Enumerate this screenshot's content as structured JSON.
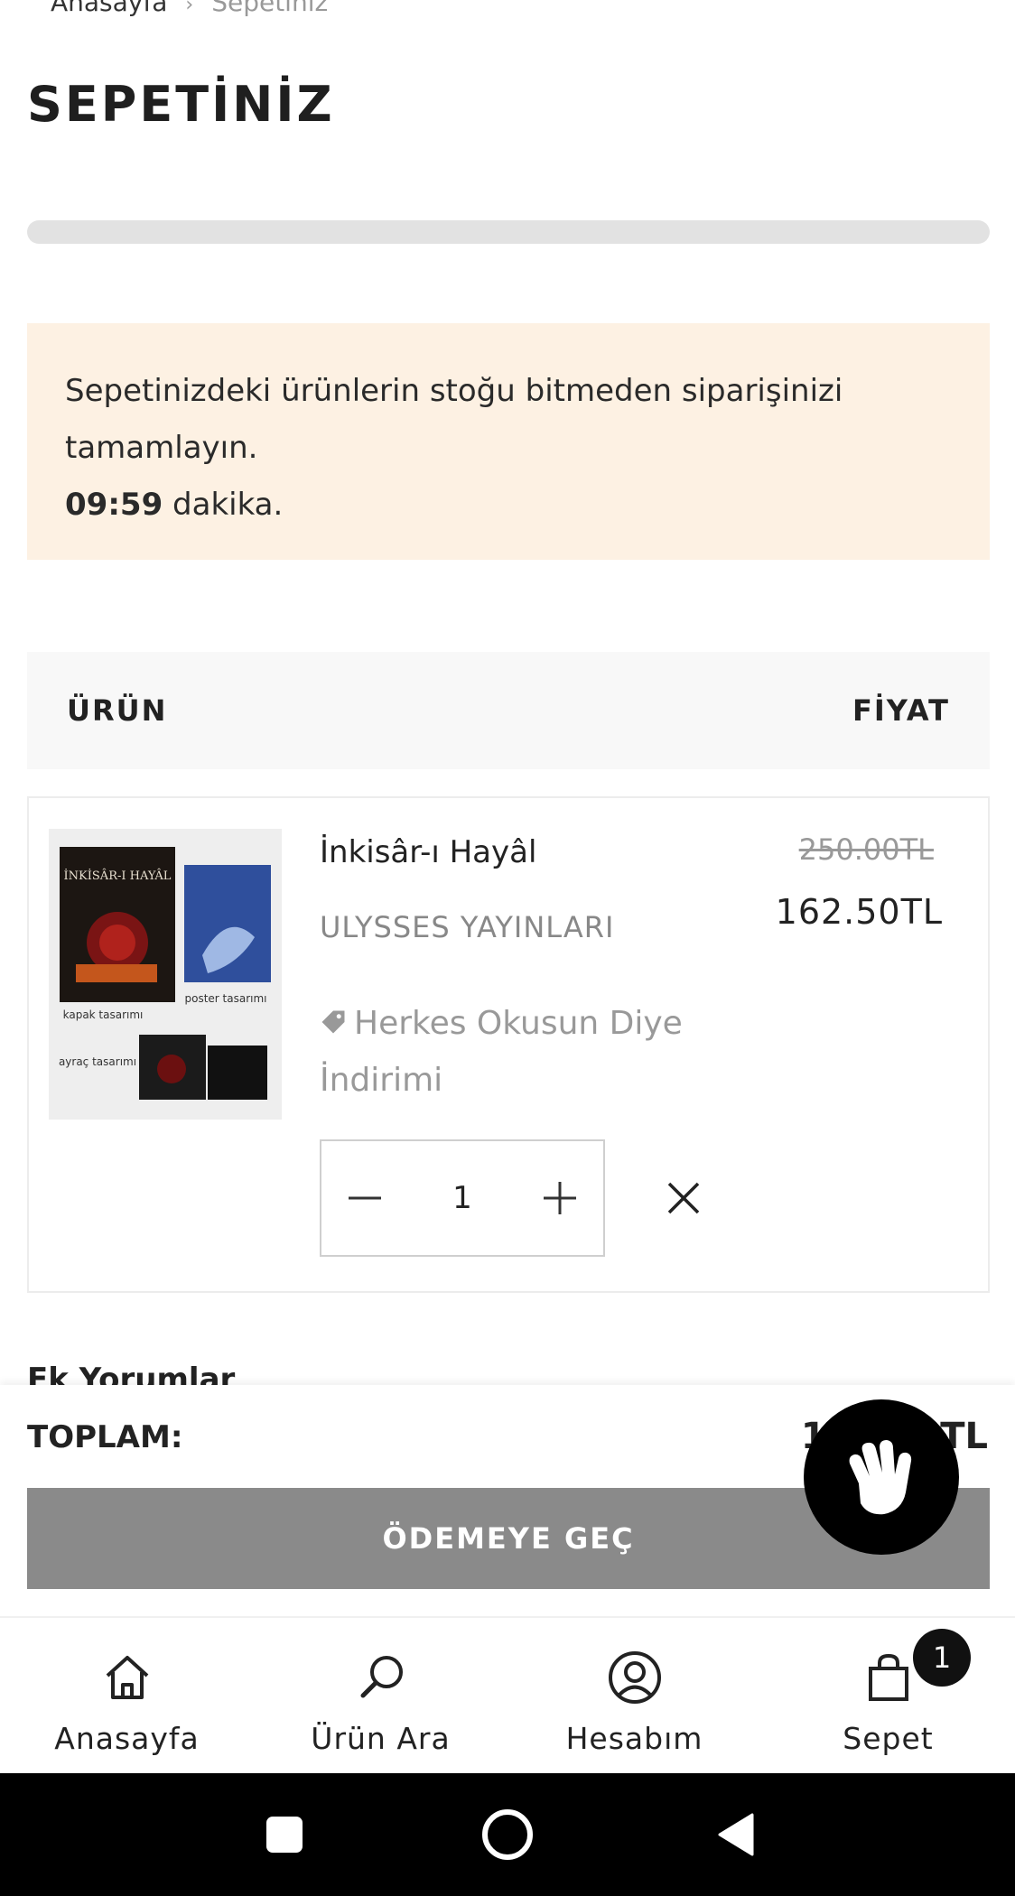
{
  "breadcrumb": {
    "home": "Anasayfa",
    "separator": "›",
    "current": "Sepetiniz"
  },
  "page_title": "SEPETİNİZ",
  "stock_banner": {
    "message": "Sepetinizdeki ürünlerin stoğu bitmeden siparişinizi tamamlayın.",
    "timer": "09:59",
    "timer_suffix": " dakika."
  },
  "table_head": {
    "product": "ÜRÜN",
    "price": "FİYAT"
  },
  "cart_item": {
    "name": "İnkisâr-ı Hayâl",
    "publisher": "ULYSSES YAYINLARI",
    "discount": "Herkes Okusun Diye İndirimi",
    "old_price": "250.00TL",
    "new_price": "162.50TL",
    "quantity": "1",
    "cover": {
      "title": "İNKİSÂR-I HAYÂL",
      "caption_kapak": "kapak tasarımı",
      "caption_poster": "poster tasarımı",
      "caption_ayrac": "ayraç tasarımı"
    }
  },
  "comments_label": "Ek Yorumlar",
  "summary": {
    "total_label": "TOPLAM:",
    "total_value": "162.50TL",
    "checkout_label": "ÖDEMEYE GEÇ"
  },
  "bottom_nav": {
    "items": [
      {
        "label": "Anasayfa",
        "icon": "home-icon"
      },
      {
        "label": "Ürün Ara",
        "icon": "search-icon"
      },
      {
        "label": "Hesabım",
        "icon": "account-icon"
      },
      {
        "label": "Sepet",
        "icon": "cart-icon"
      }
    ],
    "cart_count": "1"
  },
  "colors": {
    "banner_bg": "#fdf1e3",
    "checkout_bg": "#8a8a8a",
    "header_bg": "#f8f8f8",
    "accent": "#000000"
  }
}
